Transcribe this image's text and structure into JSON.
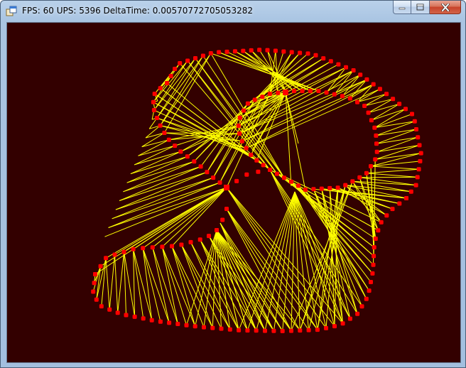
{
  "window": {
    "title": "FPS: 60 UPS: 5396 DeltaTime: 0.00570772705053282",
    "icons": {
      "app": "app-icon",
      "minimize": "minimize-icon",
      "maximize": "maximize-icon",
      "close": "close-icon"
    }
  },
  "canvas": {
    "background": "#330000",
    "vertex_color": "#ff0000",
    "edge_color": "#ffff00"
  }
}
